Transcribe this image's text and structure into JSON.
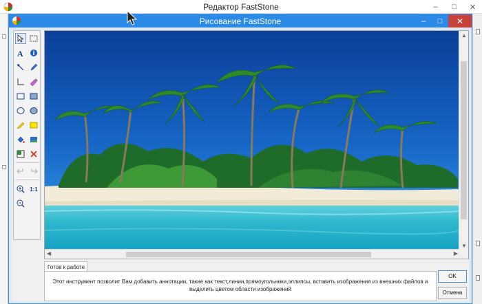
{
  "outer_window": {
    "title": "Редактор FastStone"
  },
  "dialog": {
    "title": "Рисование FastStone",
    "close_glyph": "✕",
    "minimize_glyph": "–",
    "maximize_glyph": "□"
  },
  "toolbox": {
    "tools": [
      {
        "name": "select-arrow-icon"
      },
      {
        "name": "rect-select-icon"
      },
      {
        "name": "text-icon"
      },
      {
        "name": "info-callout-icon"
      },
      {
        "name": "arrow-line-icon"
      },
      {
        "name": "pen-icon"
      },
      {
        "name": "line-icon"
      },
      {
        "name": "highlighter-icon"
      },
      {
        "name": "rectangle-icon"
      },
      {
        "name": "filled-rectangle-icon"
      },
      {
        "name": "ellipse-icon"
      },
      {
        "name": "filled-ellipse-icon"
      },
      {
        "name": "marker-icon"
      },
      {
        "name": "fill-yellow-icon"
      },
      {
        "name": "paint-bucket-icon"
      },
      {
        "name": "insert-image-icon"
      },
      {
        "name": "color-picker-icon"
      },
      {
        "name": "delete-icon"
      },
      {
        "name": "undo-icon"
      },
      {
        "name": "redo-icon"
      },
      {
        "name": "zoom-in-icon"
      },
      {
        "name": "zoom-out-icon"
      }
    ],
    "zoom_actual_label": "1:1"
  },
  "status": {
    "tab_label": "Готов к работе",
    "description": "Этот инструмент позволит Вам добавить аннотации, такие как текст,линии,прямоугольники,эллипсы, вставить изображения из внешних файлов и выделить цветом области изображений"
  },
  "buttons": {
    "ok": "OK",
    "cancel": "Отмена"
  },
  "colors": {
    "dialog_titlebar": "#2a8ae6",
    "close_button": "#c7423a",
    "sky": "#0a57b8",
    "sea": "#27b4cd"
  }
}
